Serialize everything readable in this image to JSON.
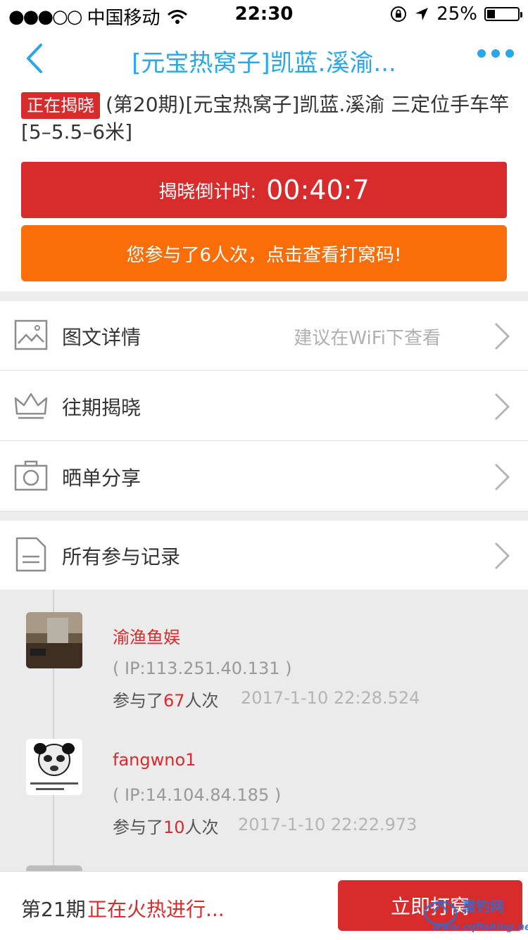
{
  "status_bar": {
    "signal_dots": "●●●○○",
    "carrier": "中国移动",
    "time": "22:30",
    "battery": "25%",
    "battery_level": 0.25
  },
  "nav": {
    "title": "[元宝热窝子]凯蓝.溪渝..."
  },
  "product": {
    "tag": "正在揭晓",
    "title": "(第20期)[元宝热窝子]凯蓝.溪渝 三定位手车竿[5–5.5–6米]"
  },
  "countdown": {
    "label": "揭晓倒计时:",
    "value": "00:40:7"
  },
  "participation_button": "您参与了6人次，点击查看打窝码!",
  "menu": [
    {
      "label": "图文详情",
      "hint": "建议在WiFi下查看",
      "icon": "image-icon"
    },
    {
      "label": "往期揭晓",
      "hint": "",
      "icon": "crown-icon"
    },
    {
      "label": "晒单分享",
      "hint": "",
      "icon": "camera-icon"
    }
  ],
  "records_header": {
    "label": "所有参与记录",
    "icon": "document-icon"
  },
  "records": [
    {
      "name": "渝渔鱼娱",
      "ip": "( IP:113.251.40.131 )",
      "times_prefix": "参与了",
      "times_count": "67",
      "times_suffix": "人次",
      "date": "2017-1-10 22:28.524"
    },
    {
      "name": "fangwno1",
      "ip": "( IP:14.104.84.185 )",
      "times_prefix": "参与了",
      "times_count": "10",
      "times_suffix": "人次",
      "date": "2017-1-10 22:22.973"
    }
  ],
  "bottom": {
    "period": "第21期",
    "status": "正在火热进行...",
    "button": "立即打窝"
  },
  "watermark": {
    "brand": "重钓网",
    "url": "www.cqfishing.net"
  },
  "colors": {
    "accent_blue": "#2aa7e8",
    "red": "#d82b2b",
    "orange": "#fa6e0a"
  }
}
